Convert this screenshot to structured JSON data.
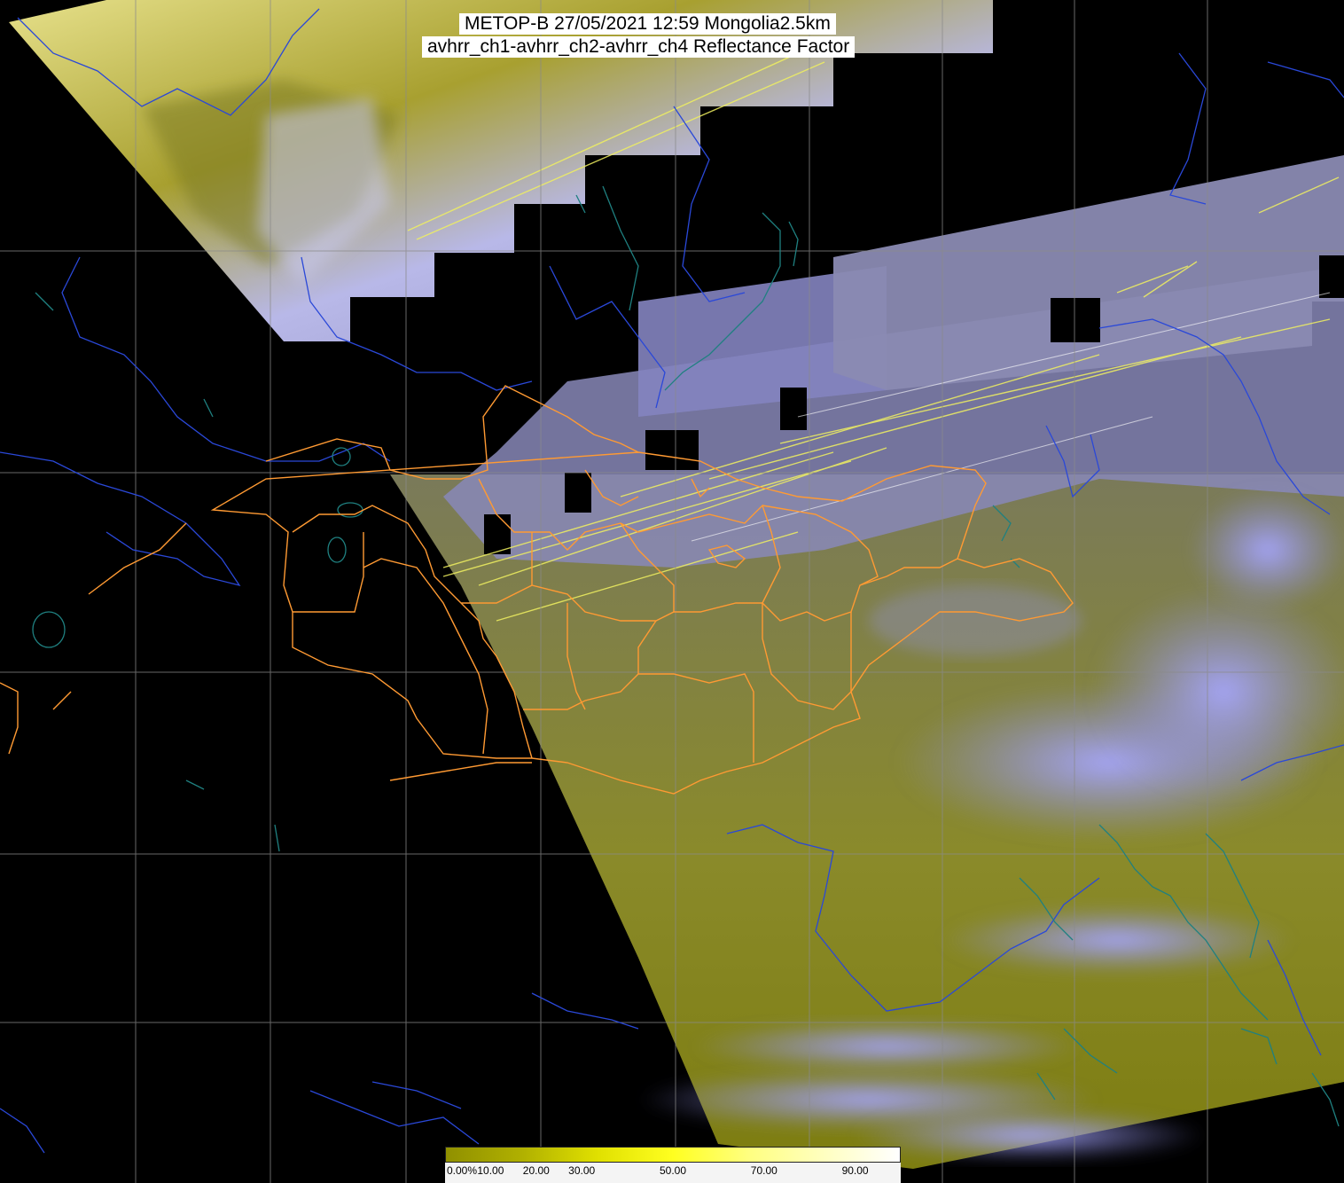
{
  "title": {
    "line1": "METOP-B 27/05/2021 12:59 Mongolia2.5km",
    "line2": "avhrr_ch1-avhrr_ch2-avhrr_ch4 Reflectance Factor"
  },
  "colors": {
    "background": "#000000",
    "grid": "#808080",
    "land_surface": "#8a8a1a",
    "cloud": "#8f8fe8",
    "coastline": "#1f7a7a",
    "country_border": "#2040c8",
    "province_border": "#ff9933"
  },
  "colorbar": {
    "labels": [
      "0.00%",
      "10.00",
      "20.00",
      "30.00",
      "50.00",
      "70.00",
      "90.00"
    ],
    "label_values": [
      0,
      10,
      20,
      30,
      50,
      70,
      90
    ],
    "range": [
      0,
      100
    ],
    "stops": [
      "#909000",
      "#b0b000",
      "#e0e000",
      "#ffff20",
      "#ffff80",
      "#ffffc0",
      "#ffffff"
    ]
  }
}
